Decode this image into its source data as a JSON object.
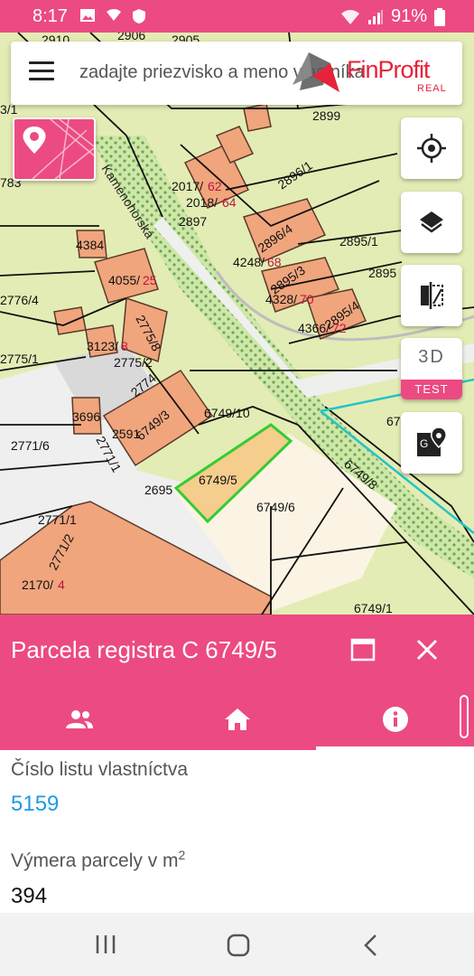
{
  "status_bar": {
    "time": "8:17",
    "battery": "91%"
  },
  "search": {
    "placeholder": "zadajte priezvisko a meno vlastníka"
  },
  "logo": {
    "brand": "FinProfit",
    "sub": "REAL"
  },
  "map": {
    "street": "Kamenohorská",
    "labels": [
      {
        "text": "2910"
      },
      {
        "text": "2906"
      },
      {
        "text": "2905"
      },
      {
        "text": "2899"
      },
      {
        "text": "2017/"
      },
      {
        "text": "62"
      },
      {
        "text": "2018/"
      },
      {
        "text": "64"
      },
      {
        "text": "2897"
      },
      {
        "text": "2896/1"
      },
      {
        "text": "2896/4"
      },
      {
        "text": "2895/1"
      },
      {
        "text": "4248/"
      },
      {
        "text": "68"
      },
      {
        "text": "2895/3"
      },
      {
        "text": "2895"
      },
      {
        "text": "4328/"
      },
      {
        "text": "70"
      },
      {
        "text": "2895/4"
      },
      {
        "text": "4366/"
      },
      {
        "text": "72"
      },
      {
        "text": "4384"
      },
      {
        "text": "4055/"
      },
      {
        "text": "25"
      },
      {
        "text": "2776/4"
      },
      {
        "text": "2775/8"
      },
      {
        "text": "3123/"
      },
      {
        "text": "8"
      },
      {
        "text": "2775/2"
      },
      {
        "text": "2775/1"
      },
      {
        "text": "2774"
      },
      {
        "text": "3696"
      },
      {
        "text": "2591"
      },
      {
        "text": "6749/3"
      },
      {
        "text": "6749/10"
      },
      {
        "text": "2771/6"
      },
      {
        "text": "2771/1"
      },
      {
        "text": "2695"
      },
      {
        "text": "6749/5"
      },
      {
        "text": "6749/6"
      },
      {
        "text": "6749/8"
      },
      {
        "text": "2771/1"
      },
      {
        "text": "2771/2"
      },
      {
        "text": "2170/"
      },
      {
        "text": "4"
      },
      {
        "text": "6749/1"
      },
      {
        "text": "67"
      },
      {
        "text": "3/1"
      },
      {
        "text": "783"
      }
    ]
  },
  "buttons": {
    "three_d": "3D",
    "test": "TEST"
  },
  "panel": {
    "title": "Parcela registra C 6749/5",
    "tabs": [
      "owners",
      "building",
      "info"
    ]
  },
  "fields": [
    {
      "label": "Číslo listu vlastníctva",
      "value": "5159"
    },
    {
      "label": "Výmera parcely v m",
      "sup": "2",
      "value": "394"
    }
  ],
  "colors": {
    "accent": "#ec4a82",
    "building": "#f0a57d",
    "link": "#1e9be3",
    "selected": "#33cc33"
  }
}
